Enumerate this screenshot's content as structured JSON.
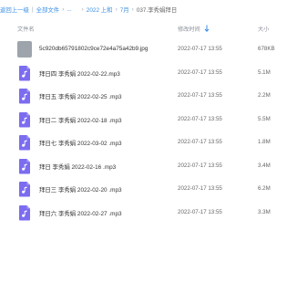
{
  "breadcrumb": {
    "back": "返回上一级",
    "all_files": "全部文件",
    "ellipsis": "...",
    "year_folder": "2022 上和",
    "month_folder": "7月",
    "current": "037.李秀娟拜日"
  },
  "columns": {
    "name": "文件名",
    "modified": "修改时间",
    "size": "大小"
  },
  "files": [
    {
      "name": "5c920db65791802c9ce72e4a75a42b9.jpg",
      "modified": "2022-07-17 13:55",
      "size": "678KB",
      "icon": "image-thumbnail"
    },
    {
      "name": "拜日四 李秀娟 2022-02-22.mp3",
      "modified": "2022-07-17 13:55",
      "size": "5.1M",
      "icon": "audio-file-icon"
    },
    {
      "name": "拜日五 李秀娟 2022-02-25 .mp3",
      "modified": "2022-07-17 13:55",
      "size": "2.2M",
      "icon": "audio-file-icon"
    },
    {
      "name": "拜日二 李秀娟 2022-02-18 .mp3",
      "modified": "2022-07-17 13:55",
      "size": "5.5M",
      "icon": "audio-file-icon"
    },
    {
      "name": "拜日七 李秀娟 2022-03-02 .mp3",
      "modified": "2022-07-17 13:55",
      "size": "1.8M",
      "icon": "audio-file-icon"
    },
    {
      "name": "拜日 李秀娟 2022-02-16 .mp3",
      "modified": "2022-07-17 13:55",
      "size": "3.4M",
      "icon": "audio-file-icon"
    },
    {
      "name": "拜日三 李秀娟 2022-02-20 .mp3",
      "modified": "2022-07-17 13:55",
      "size": "6.2M",
      "icon": "audio-file-icon"
    },
    {
      "name": "拜日六 李秀娟 2022-02-27 .mp3",
      "modified": "2022-07-17 13:55",
      "size": "3.3M",
      "icon": "audio-file-icon"
    }
  ],
  "colors": {
    "link": "#3a8fe5",
    "audio_icon": "#7b6cf0",
    "thumb": "#9ea4ab"
  }
}
